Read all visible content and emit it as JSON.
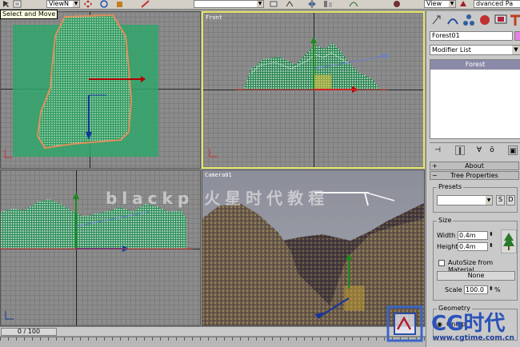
{
  "toolbar": {
    "tooltip": "Select and Move",
    "combo_left": "ViewN",
    "combo_right": "View",
    "combo_far": "dvanced Pa"
  },
  "viewports": {
    "top": {
      "label": ""
    },
    "front": {
      "label": "Front"
    },
    "left": {
      "label": ""
    },
    "camera": {
      "label": "Camera01"
    }
  },
  "panel": {
    "object_name": "Forest01",
    "modifier_list": "Modifier List",
    "stack_items": [
      "Forest"
    ],
    "rollouts": {
      "about": "About",
      "tree_properties": "Tree Properties"
    },
    "presets": {
      "title": "Presets",
      "value": "",
      "save_label": "S",
      "delete_label": "D"
    },
    "size": {
      "title": "Size",
      "width_label": "Width",
      "width_value": "0.4m",
      "height_label": "Height",
      "height_value": "0.4m"
    },
    "autosize_label": "AutoSize from Material",
    "autosize_checked": false,
    "material_button": "None",
    "scale_label": "Scale",
    "scale_value": "100.0",
    "scale_unit": "%",
    "geometry": {
      "title": "Geometry",
      "option_label": "One pl"
    }
  },
  "timeline": {
    "slider_text": "0 / 100"
  },
  "watermarks": {
    "center": "blackp 火星时代教程",
    "brand": "CG时代",
    "url": "www.cgtime.com.cn"
  },
  "colors": {
    "active_viewport": "#e5e567",
    "tree_green": "#2fa56b",
    "stack_selected": "#8a8aa8",
    "object_color": "#e87fe6"
  }
}
